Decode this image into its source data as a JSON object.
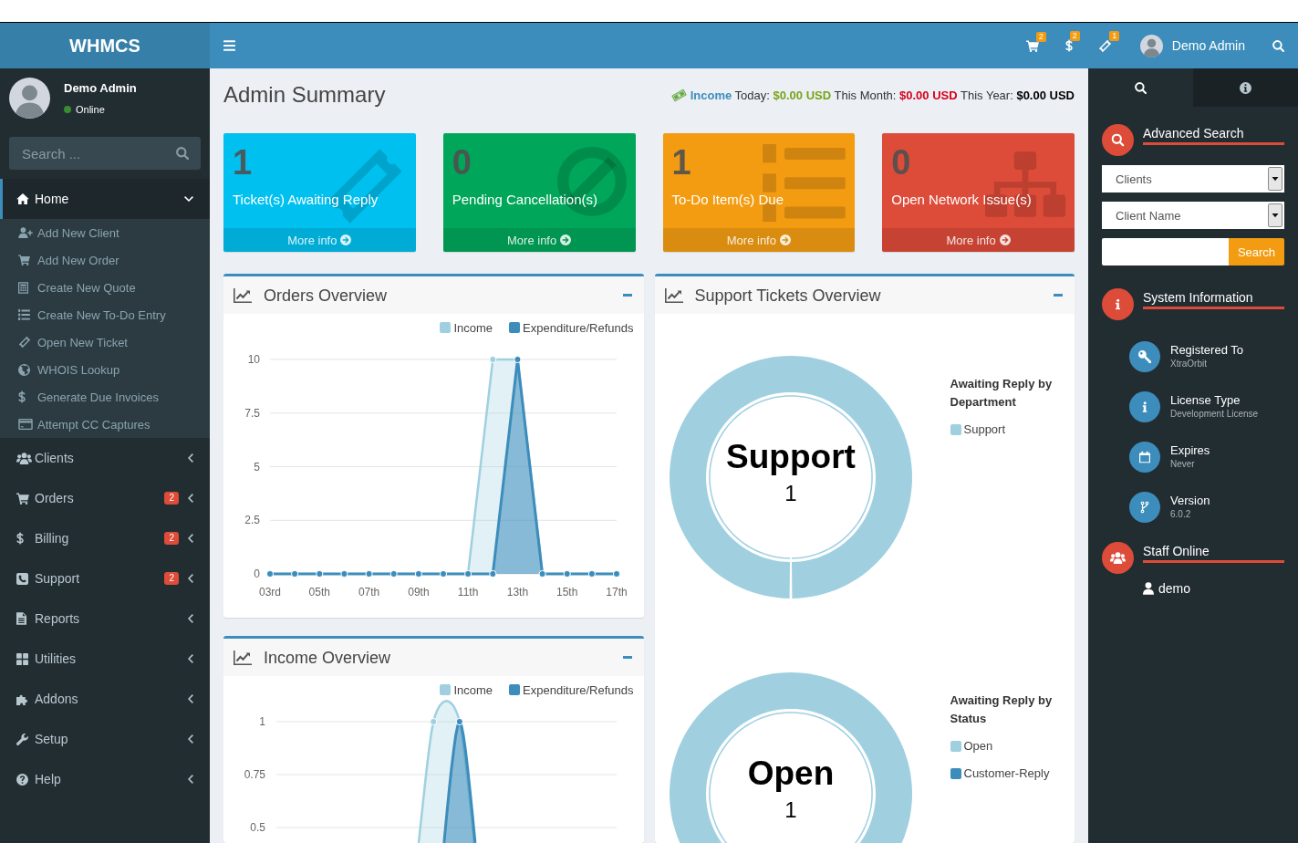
{
  "header": {
    "logo": "WHMCS",
    "notifications": [
      {
        "count": "2"
      },
      {
        "count": "2"
      },
      {
        "count": "1"
      }
    ],
    "user_name": "Demo Admin"
  },
  "sidebar": {
    "user": {
      "name": "Demo Admin",
      "status": "Online",
      "online": true
    },
    "search": {
      "placeholder": "Search ..."
    },
    "menu": [
      {
        "label": "Home",
        "selected": true,
        "expanded": true,
        "children": [
          {
            "label": "Add New Client",
            "selected": false
          },
          {
            "label": "Add New Order",
            "selected": false
          },
          {
            "label": "Create New Quote",
            "selected": false
          },
          {
            "label": "Create New To-Do Entry",
            "selected": false
          },
          {
            "label": "Open New Ticket",
            "selected": false
          },
          {
            "label": "WHOIS Lookup",
            "selected": false
          },
          {
            "label": "Generate Due Invoices",
            "selected": false
          },
          {
            "label": "Attempt CC Captures",
            "selected": false
          }
        ]
      },
      {
        "label": "Clients",
        "selected": false,
        "expanded": false
      },
      {
        "label": "Orders",
        "selected": false,
        "expanded": false,
        "badge": "2"
      },
      {
        "label": "Billing",
        "selected": false,
        "expanded": false,
        "badge": "2"
      },
      {
        "label": "Support",
        "selected": false,
        "expanded": false,
        "badge": "2"
      },
      {
        "label": "Reports",
        "selected": false,
        "expanded": false
      },
      {
        "label": "Utilities",
        "selected": false,
        "expanded": false
      },
      {
        "label": "Addons",
        "selected": false,
        "expanded": false
      },
      {
        "label": "Setup",
        "selected": false,
        "expanded": false
      },
      {
        "label": "Help",
        "selected": false,
        "expanded": false
      }
    ]
  },
  "page": {
    "title": "Admin Summary",
    "income": {
      "label": "Income",
      "figures": [
        {
          "label": "Today:",
          "value": "$0.00 USD",
          "color": "#79a318"
        },
        {
          "label": "This Month:",
          "value": "$0.00 USD",
          "color": "#d8001c"
        },
        {
          "label": "This Year:",
          "value": "$0.00 USD",
          "color": "#000000"
        }
      ]
    },
    "stats": [
      {
        "value": "1",
        "label": "Ticket(s) Awaiting Reply",
        "link": "More info",
        "color": "#00c0ef"
      },
      {
        "value": "0",
        "label": "Pending Cancellation(s)",
        "link": "More info",
        "color": "#00a65a"
      },
      {
        "value": "1",
        "label": "To-Do Item(s) Due",
        "link": "More info",
        "color": "#f39c12"
      },
      {
        "value": "0",
        "label": "Open Network Issue(s)",
        "link": "More info",
        "color": "#dd4b39"
      }
    ],
    "orders_overview": {
      "title": "Orders Overview",
      "chart_data": {
        "type": "area",
        "stacked": false,
        "x": [
          3,
          4,
          5,
          6,
          7,
          8,
          9,
          10,
          11,
          12,
          13,
          14,
          15,
          16,
          17
        ],
        "xlim": [
          3,
          17
        ],
        "ylim": [
          0,
          10
        ],
        "grid": true,
        "xticks": [
          {
            "value": 3,
            "label": "03rd"
          },
          {
            "value": 5,
            "label": "05th"
          },
          {
            "value": 7,
            "label": "07th"
          },
          {
            "value": 9,
            "label": "09th"
          },
          {
            "value": 11,
            "label": "11th"
          },
          {
            "value": 13,
            "label": "13th"
          },
          {
            "value": 15,
            "label": "15th"
          },
          {
            "value": 17,
            "label": "17th"
          }
        ],
        "yticks": [
          0,
          2.5,
          5,
          7.5,
          10
        ],
        "series": [
          {
            "name": "Income",
            "color": "#a0d0e0",
            "values": [
              null,
              null,
              null,
              null,
              null,
              null,
              null,
              null,
              0,
              10,
              10,
              0,
              null,
              null,
              null
            ]
          },
          {
            "name": "Expenditure/Refunds",
            "color": "#3c8dbc",
            "values": [
              0,
              0,
              0,
              0,
              0,
              0,
              0,
              0,
              0,
              0,
              10,
              0,
              0,
              0,
              0
            ]
          }
        ]
      }
    },
    "income_overview": {
      "title": "Income Overview",
      "legend": [
        {
          "label": "Income",
          "color": "#a0d0e0"
        },
        {
          "label": "Expenditure/Refunds",
          "color": "#3c8dbc"
        }
      ],
      "y_labels": [
        "1",
        "0.75",
        "0.5"
      ]
    },
    "support_overview": {
      "title": "Support Tickets Overview",
      "charts": [
        {
          "center_label": "Support",
          "center_value": "1",
          "chart_data": {
            "type": "donut",
            "title": "Awaiting Reply by Department",
            "categories": [
              "Support"
            ],
            "values": [
              1
            ],
            "colors": [
              "#a0d0e0"
            ]
          }
        },
        {
          "center_label": "Open",
          "center_value": "1",
          "chart_data": {
            "type": "donut",
            "title": "Awaiting Reply by Status",
            "categories": [
              "Open",
              "Customer-Reply"
            ],
            "values": [
              1,
              0
            ],
            "colors": [
              "#a0d0e0",
              "#3c8dbc"
            ]
          }
        }
      ]
    }
  },
  "control_sidebar": {
    "tabs": [
      {
        "selected": true
      },
      {
        "selected": false
      }
    ],
    "advanced_search": {
      "title": "Advanced Search",
      "selects": [
        {
          "value": "Clients"
        },
        {
          "value": "Client Name"
        }
      ],
      "button": "Search"
    },
    "system_information": {
      "title": "System Information",
      "items": [
        {
          "label": "Registered To",
          "value": "XtraOrbit"
        },
        {
          "label": "License Type",
          "value": "Development License"
        },
        {
          "label": "Expires",
          "value": "Never"
        },
        {
          "label": "Version",
          "value": "6.0.2"
        }
      ]
    },
    "staff_online": {
      "title": "Staff Online",
      "staff": [
        {
          "name": "demo"
        }
      ]
    }
  }
}
